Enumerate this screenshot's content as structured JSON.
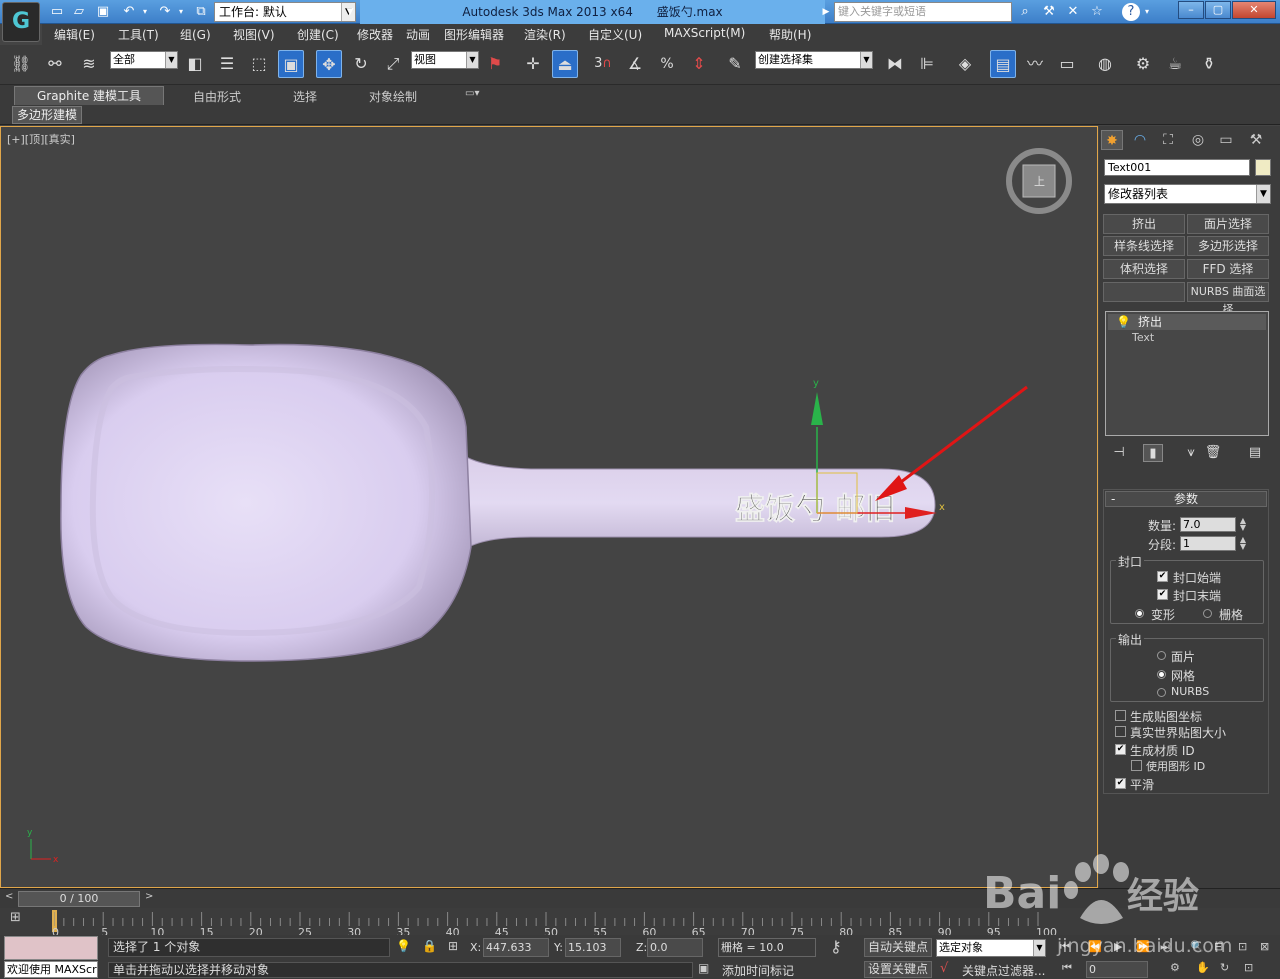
{
  "titlebar": {
    "workspace_label": "工作台: 默认",
    "app_name": "Autodesk 3ds Max  2013 x64",
    "file_name": "盛饭勺.max",
    "search_placeholder": "键入关键字或短语"
  },
  "menu": [
    "编辑(E)",
    "工具(T)",
    "组(G)",
    "视图(V)",
    "创建(C)",
    "修改器",
    "动画",
    "图形编辑器",
    "渲染(R)",
    "自定义(U)",
    "MAXScript(M)",
    "帮助(H)"
  ],
  "toolbar": {
    "selection_filter": "全部",
    "ref_coord": "视图",
    "snap3": "3",
    "named_selection": "创建选择集"
  },
  "ribbon": {
    "tabs": [
      "Graphite 建模工具",
      "自由形式",
      "选择",
      "对象绘制"
    ],
    "sub_panel": "多边形建模"
  },
  "viewport": {
    "label": "[+][顶][真实]",
    "engraved_text": "盛饭勺 邮旧",
    "axis_x": "x",
    "axis_y": "y"
  },
  "command_panel": {
    "object_name": "Text001",
    "modifier_list": "修改器列表",
    "modifier_buttons": [
      "挤出",
      "面片选择",
      "样条线选择",
      "多边形选择",
      "体积选择",
      "FFD 选择",
      "",
      "NURBS 曲面选择"
    ],
    "stack": [
      "挤出",
      "Text"
    ],
    "params": {
      "title": "参数",
      "amount_label": "数量:",
      "amount": "7.0",
      "segments_label": "分段:",
      "segments": "1",
      "capping": {
        "title": "封口",
        "cap_start": "封口始端",
        "cap_end": "封口末端",
        "morph": "变形",
        "grid": "栅格"
      },
      "output": {
        "title": "输出",
        "patch": "面片",
        "mesh": "网格",
        "nurbs": "NURBS"
      },
      "gen_mapping": "生成贴图坐标",
      "real_world": "真实世界贴图大小",
      "gen_mat_id": "生成材质 ID",
      "use_shape_id": "使用图形 ID",
      "smooth": "平滑"
    }
  },
  "timeline": {
    "slider": "0 / 100",
    "ticks": [
      "0",
      "5",
      "10",
      "15",
      "20",
      "25",
      "30",
      "35",
      "40",
      "45",
      "50",
      "55",
      "60",
      "65",
      "70",
      "75",
      "80",
      "85",
      "90",
      "95",
      "100"
    ]
  },
  "status": {
    "selected": "选择了 1 个对象",
    "hint": "单击并拖动以选择并移动对象",
    "welcome": "欢迎使用 MAXScri",
    "x_label": "X:",
    "x": "447.633",
    "y_label": "Y:",
    "y": "15.103",
    "z_label": "Z:",
    "z": "0.0",
    "grid": "栅格 = 10.0",
    "auto_key": "自动关键点",
    "set_key": "设置关键点",
    "key_mode": "选定对象",
    "key_filter": "关键点过滤器...",
    "add_time_tag": "添加时间标记",
    "frame": "0"
  },
  "watermark": {
    "brand": "Bai",
    "brand2": "经验",
    "url": "jingyan.baidu.com"
  }
}
